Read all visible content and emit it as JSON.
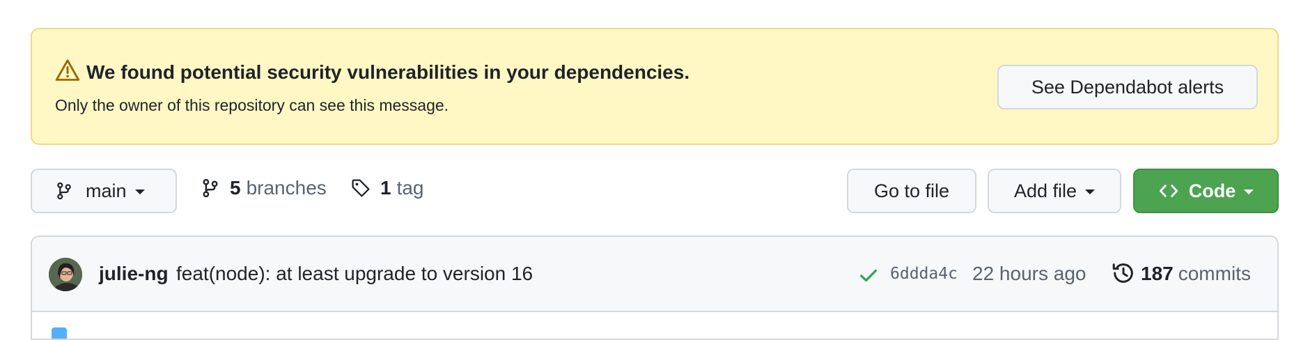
{
  "alert": {
    "title": "We found potential security vulnerabilities in your dependencies.",
    "subtitle": "Only the owner of this repository can see this message.",
    "button_label": "See Dependabot alerts",
    "icon": "alert-triangle-icon"
  },
  "toolbar": {
    "branch": {
      "label": "main",
      "icon": "git-branch-icon"
    },
    "branches": {
      "count": "5",
      "word": "branches",
      "icon": "git-branch-icon"
    },
    "tags": {
      "count": "1",
      "word": "tag",
      "icon": "tag-icon"
    },
    "go_to_file_label": "Go to file",
    "add_file_label": "Add file",
    "code_label": "Code"
  },
  "commit": {
    "author": "julie-ng",
    "message": "feat(node): at least upgrade to version 16",
    "status": "success",
    "sha": "6ddda4c",
    "time": "22 hours ago",
    "commits_count": "187",
    "commits_word": "commits"
  },
  "colors": {
    "alert_bg": "#fff8c5",
    "alert_border": "#eed888",
    "code_button_bg": "#4ca350",
    "success_check": "#2da44e",
    "muted_text": "#59636e"
  }
}
